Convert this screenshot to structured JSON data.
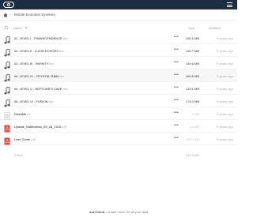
{
  "breadcrumb": {
    "share_name": "Mobile Evolution Sysetem"
  },
  "columns": {
    "name": "Name",
    "sort_indicator": "▲",
    "size": "Size",
    "modified": "Modified"
  },
  "files": [
    {
      "name": "01. LEVEL I - TRANSCENDENCE",
      "ext": ".flac",
      "size": "190.6 MB",
      "modified": "8 years ago",
      "type": "audio",
      "actions": "•••",
      "highlight": false,
      "size_light": false
    },
    {
      "name": "02. LEVEL II - LUCID ECHOES",
      "ext": ".flac",
      "size": "130.7 MB",
      "modified": "8 years ago",
      "type": "audio",
      "actions": "•••",
      "highlight": false,
      "size_light": false
    },
    {
      "name": "03. LEVEL III - INFINITY",
      "ext": ".flac",
      "size": "149.6 MB",
      "modified": "8 years ago",
      "type": "audio",
      "actions": "•••",
      "highlight": false,
      "size_light": false
    },
    {
      "name": "04. LEVEL IV - CRYSTAL RAIN",
      "ext": ".flac",
      "size": "160.6 MB",
      "modified": "8 years ago",
      "type": "audio",
      "actions": "•••",
      "highlight": true,
      "size_light": false
    },
    {
      "name": "05. LEVEL V - NEPTUNE'S CAVE",
      "ext": ".flac",
      "size": "133.1 MB",
      "modified": "8 years ago",
      "type": "audio",
      "actions": "•••",
      "highlight": false,
      "size_light": false
    },
    {
      "name": "06. LEVEL VI - FUSION",
      "ext": ".flac",
      "size": "174.0 MB",
      "modified": "8 years ago",
      "type": "audio",
      "actions": "•••",
      "highlight": false,
      "size_light": false
    },
    {
      "name": "ReadMe",
      "ext": ".txt",
      "size": "6 KB",
      "modified": "8 years ago",
      "type": "text",
      "actions": "•••",
      "highlight": false,
      "size_light": true
    },
    {
      "name": "Update_Notification_05_26_2015",
      "ext": ".pdf",
      "size": "1.4 MB",
      "modified": "8 years ago",
      "type": "pdf",
      "actions": "•••",
      "highlight": false,
      "size_light": true
    },
    {
      "name": "User Guide",
      "ext": ".pdf",
      "size": "107.2 KB",
      "modified": "8 years ago",
      "type": "pdf",
      "actions": "•••",
      "highlight": false,
      "size_light": true
    }
  ],
  "summary": {
    "count": "9 files",
    "total": "940.5 MB"
  },
  "footer": {
    "brand": "ownCloud",
    "tagline": " – A safe home for all your data"
  },
  "colors": {
    "topbar": "#1d2d44",
    "pdf": "#e24a3b",
    "audio_icon": "#555555"
  }
}
